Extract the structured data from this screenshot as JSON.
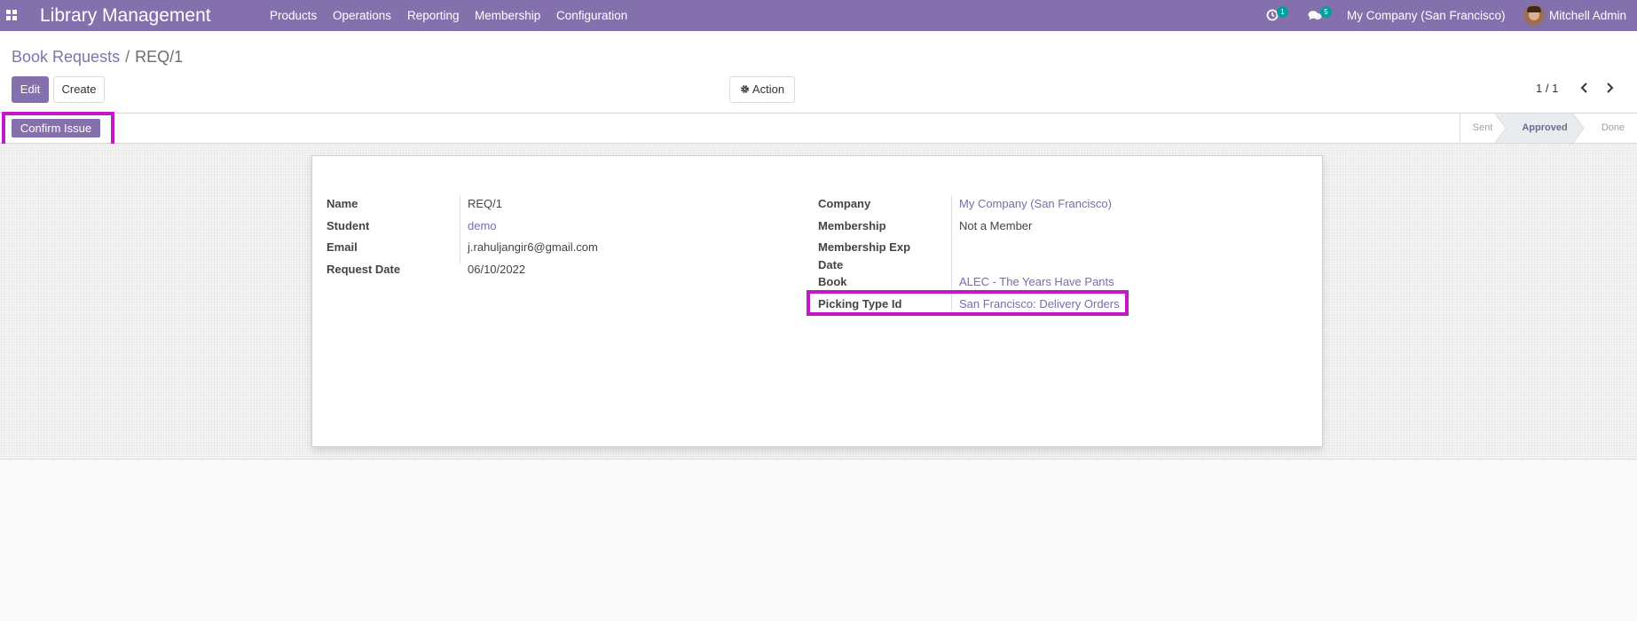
{
  "navbar": {
    "brand": "Library Management",
    "menu": [
      "Products",
      "Operations",
      "Reporting",
      "Membership",
      "Configuration"
    ],
    "activity_count": "1",
    "message_count": "5",
    "company": "My Company (San Francisco)",
    "user": "Mitchell Admin"
  },
  "breadcrumb": {
    "parent": "Book Requests",
    "separator": "/",
    "current": "REQ/1"
  },
  "toolbar": {
    "edit_label": "Edit",
    "create_label": "Create",
    "action_label": "Action"
  },
  "pager": {
    "text": "1 / 1"
  },
  "statusbar": {
    "confirm_label": "Confirm Issue",
    "stages": [
      {
        "label": "Sent",
        "active": false
      },
      {
        "label": "Approved",
        "active": true
      },
      {
        "label": "Done",
        "active": false
      }
    ]
  },
  "form": {
    "left": [
      {
        "label": "Name",
        "value": "REQ/1",
        "is_link": false
      },
      {
        "label": "Student",
        "value": "demo",
        "is_link": true
      },
      {
        "label": "Email",
        "value": "j.rahuljangir6@gmail.com",
        "is_link": false
      },
      {
        "label": "Request Date",
        "value": "06/10/2022",
        "is_link": false
      }
    ],
    "right": {
      "company_label": "Company",
      "company_value": "My Company (San Francisco)",
      "membership_label": "Membership",
      "membership_value": "Not a Member",
      "membership_exp_label_line1": "Membership Exp",
      "membership_exp_label_line2": "Date",
      "membership_exp_value": "",
      "book_label": "Book",
      "book_value": "ALEC - The Years Have Pants",
      "picking_label": "Picking Type Id",
      "picking_value": "San Francisco: Delivery Orders"
    }
  },
  "colors": {
    "brand": "#8470ac",
    "highlight": "#c318c8",
    "badge": "#00a09d"
  }
}
